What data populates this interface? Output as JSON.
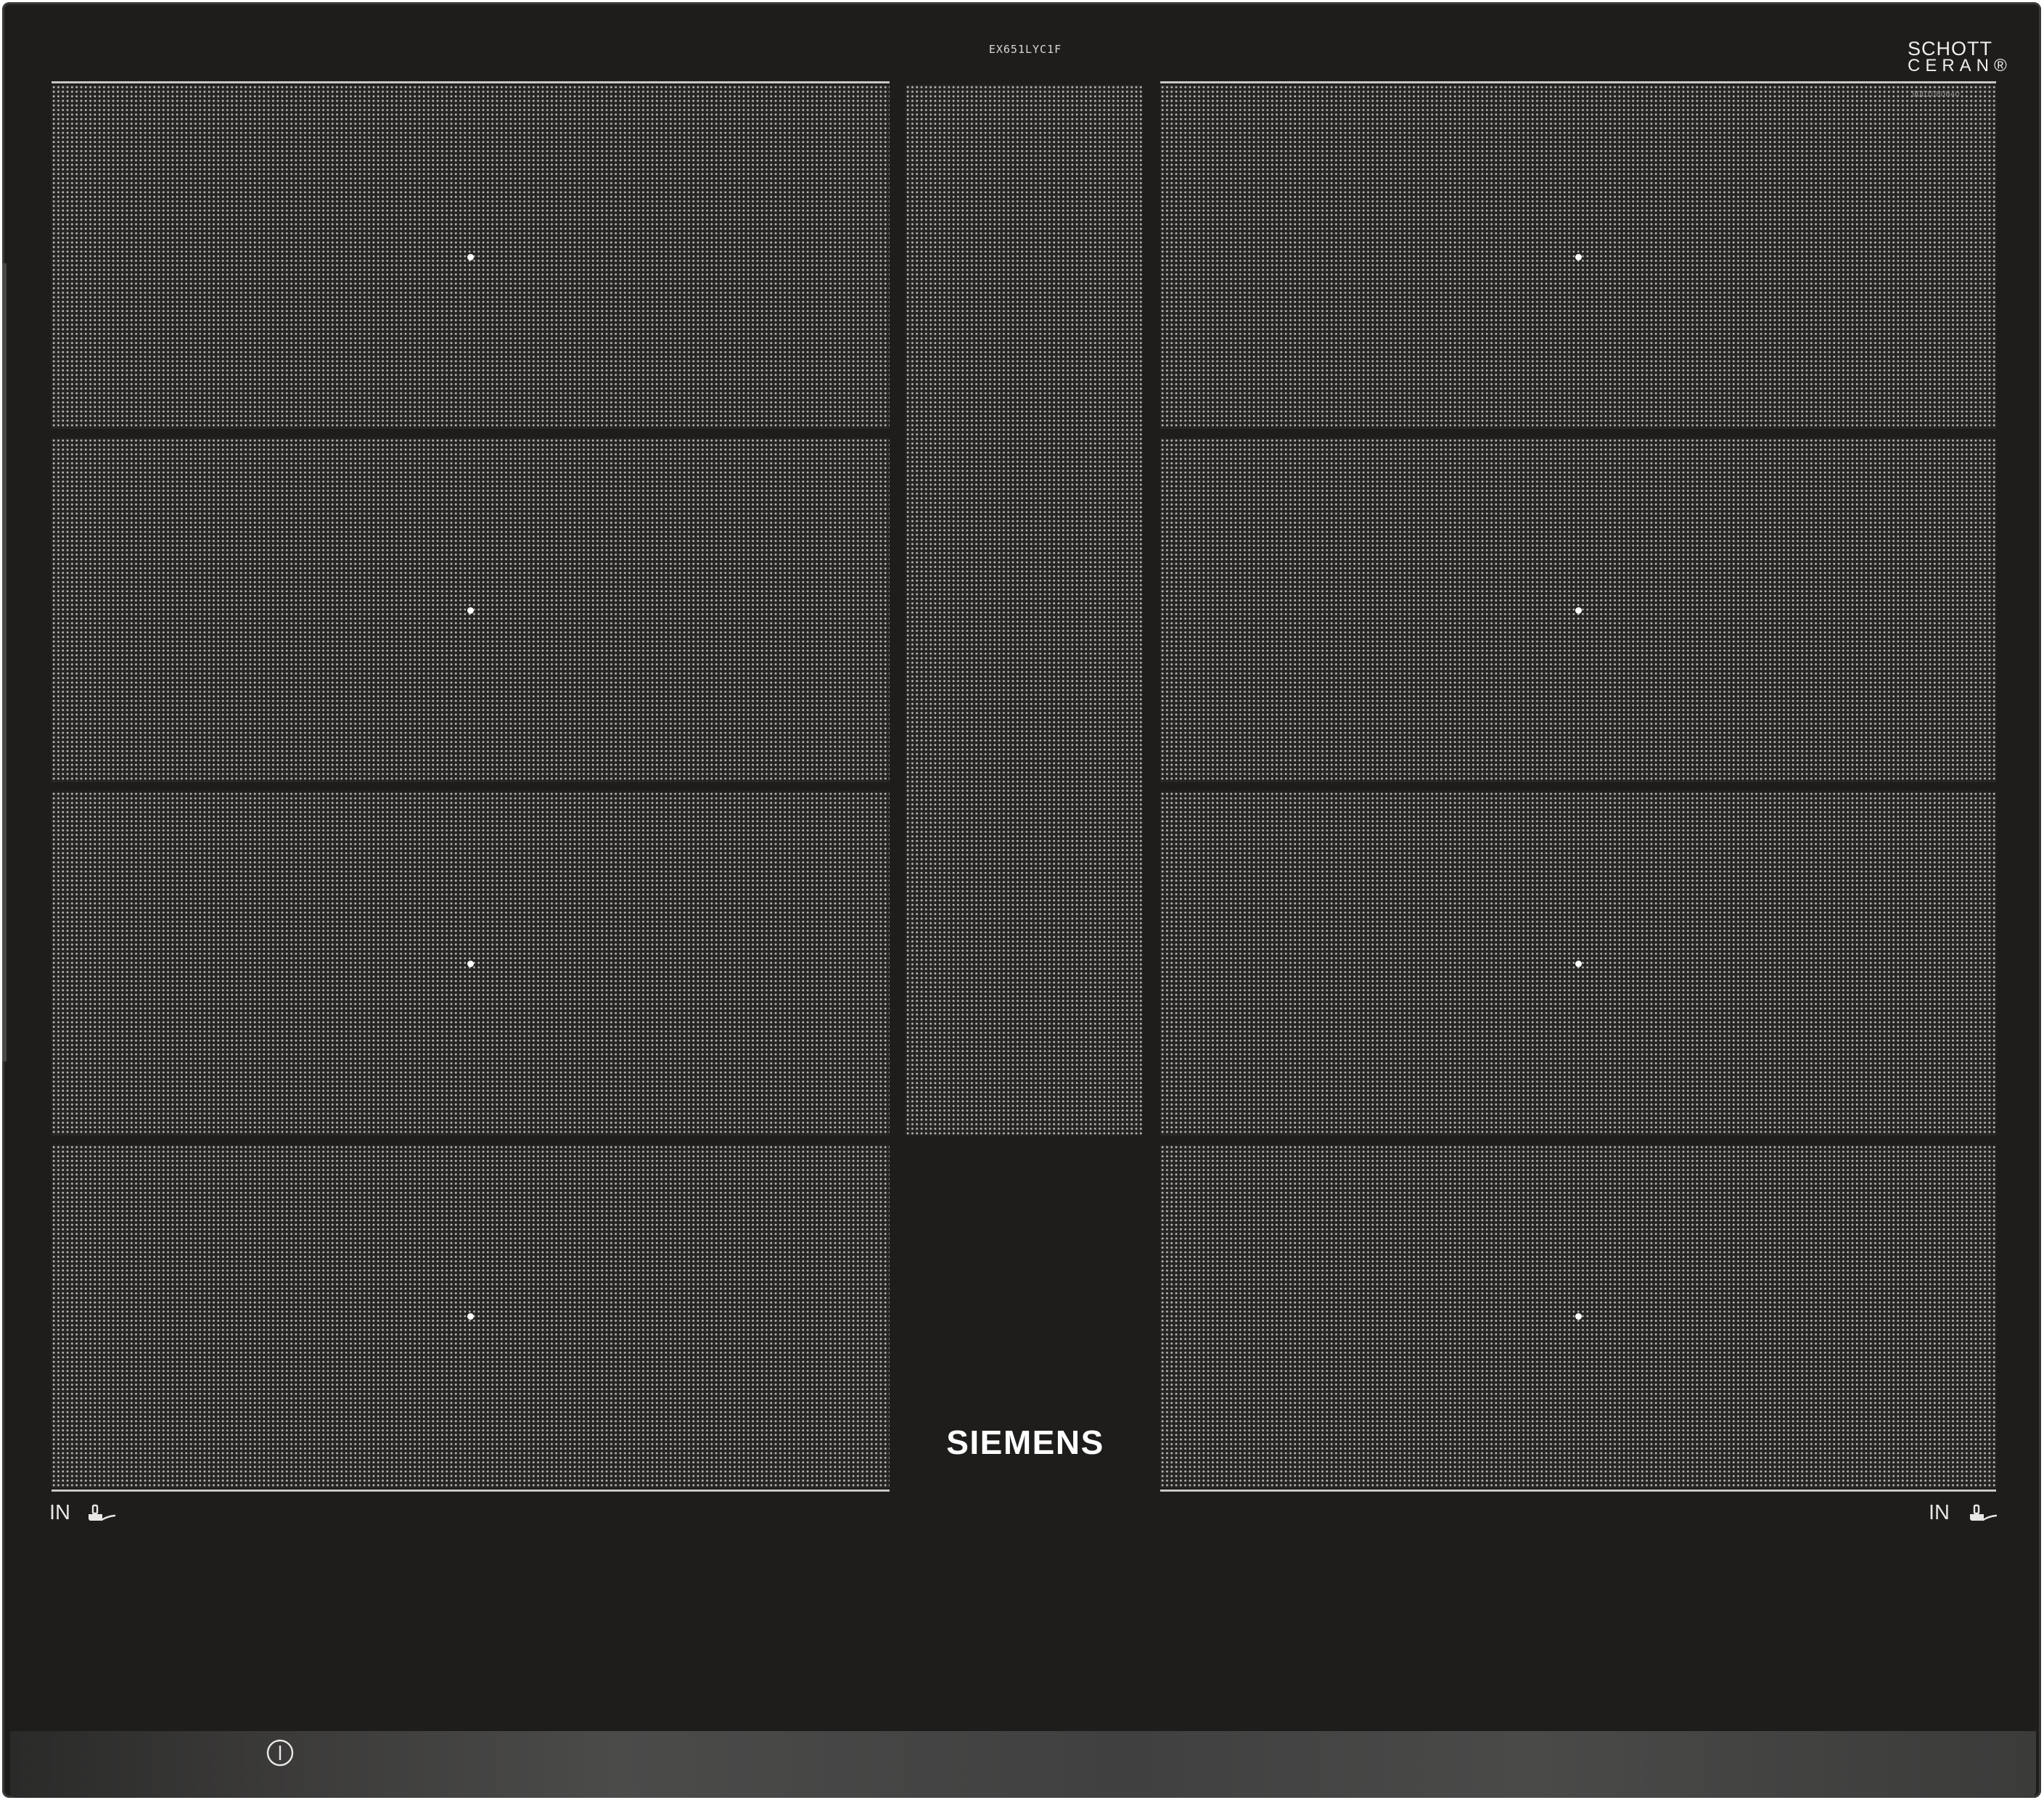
{
  "hob": {
    "model": "EX651LYC1F",
    "glass_brand_line1": "SCHOTT",
    "glass_brand_line2": "CERAN®",
    "serial": "9001080840",
    "brand": "SIEMENS",
    "left_label": "IN",
    "right_label": "IN",
    "icons": {
      "pot_left": "pot-sensor-icon",
      "pot_right": "pot-sensor-icon",
      "power": "power-icon"
    }
  },
  "colors": {
    "glass": "#1e1d1b",
    "dot_pattern": "#b8b7b4",
    "text": "#ffffff"
  }
}
